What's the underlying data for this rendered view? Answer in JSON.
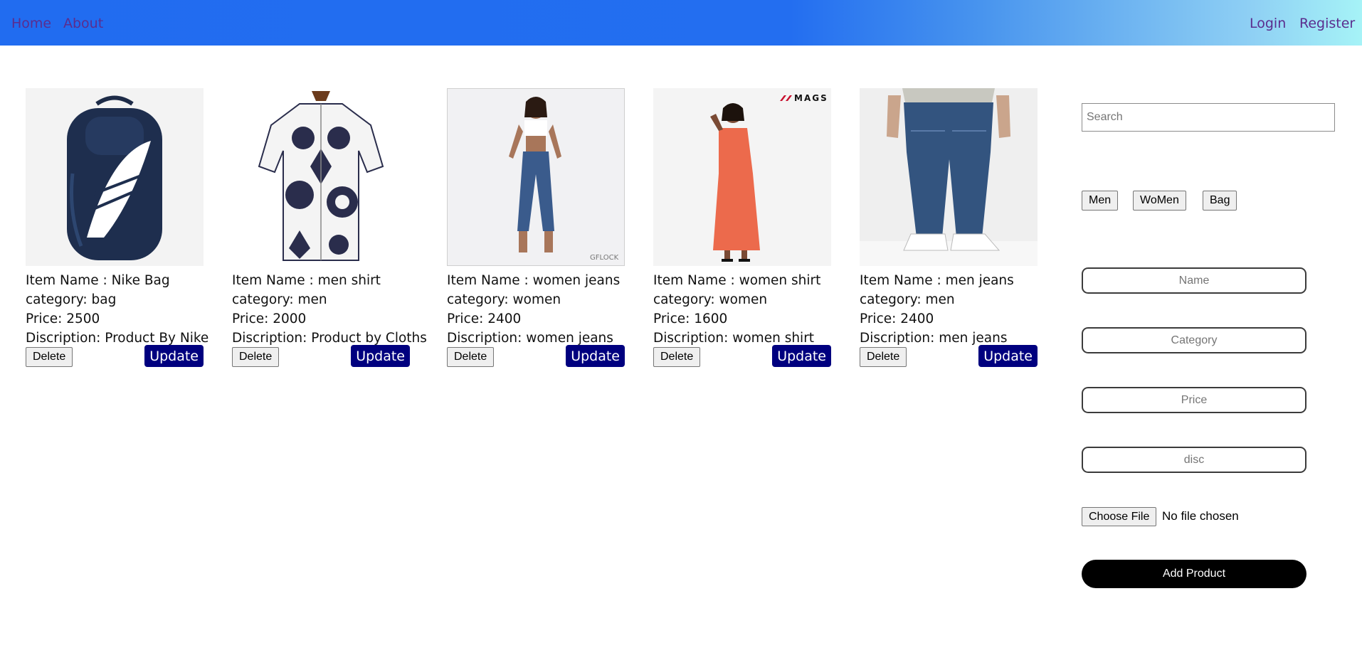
{
  "nav": {
    "home": "Home",
    "about": "About",
    "login": "Login",
    "register": "Register"
  },
  "products": [
    {
      "name": "Item Name : Nike Bag",
      "category": "category: bag",
      "price": "Price: 2500",
      "description": "Discription: Product By Nike",
      "image": "backpack-image",
      "delete_label": "Delete",
      "update_label": "Update"
    },
    {
      "name": "Item Name : men shirt",
      "category": "category: men",
      "price": "Price: 2000",
      "description": "Discription: Product by Cloths",
      "image": "shirt-image",
      "delete_label": "Delete",
      "update_label": "Update"
    },
    {
      "name": "Item Name : women jeans",
      "category": "category: women",
      "price": "Price: 2400",
      "description": "Discription: women jeans",
      "image": "women-jeans-image",
      "delete_label": "Delete",
      "update_label": "Update",
      "image_watermark": "GFLOCK"
    },
    {
      "name": "Item Name : women shirt",
      "category": "category: women",
      "price": "Price: 1600",
      "description": "Discription: women shirt",
      "image": "women-dress-image",
      "delete_label": "Delete",
      "update_label": "Update",
      "image_logo": "MAGS"
    },
    {
      "name": "Item Name : men jeans",
      "category": "category: men",
      "price": "Price: 2400",
      "description": "Discription: men jeans",
      "image": "men-jeans-image",
      "delete_label": "Delete",
      "update_label": "Update"
    }
  ],
  "sidebar": {
    "search_placeholder": "Search",
    "filters": [
      "Men",
      "WoMen",
      "Bag"
    ],
    "form": {
      "name_placeholder": "Name",
      "category_placeholder": "Category",
      "price_placeholder": "Price",
      "disc_placeholder": "disc",
      "file_button": "Choose File",
      "file_status": "No file chosen",
      "submit_label": "Add Product"
    }
  },
  "colors": {
    "navbar_start": "#216cf0",
    "navbar_end": "#a6f3f7",
    "nav_link": "#5b2d8e",
    "update_button": "#00007f",
    "add_button": "#000000"
  }
}
